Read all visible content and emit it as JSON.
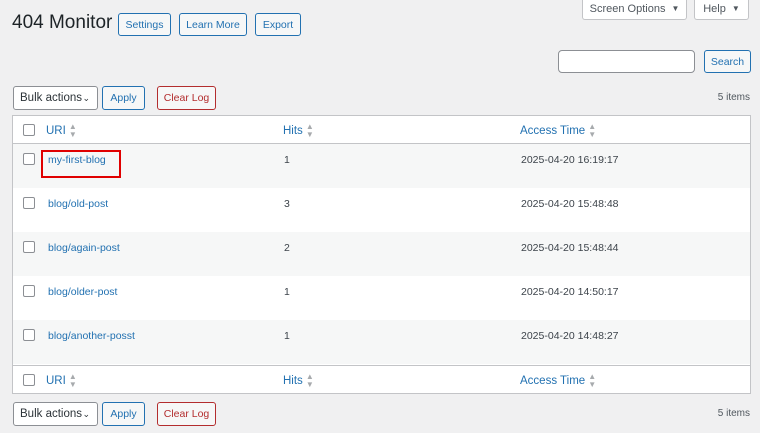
{
  "header": {
    "screen_options_label": "Screen Options",
    "help_label": "Help",
    "title": "404 Monitor",
    "settings_label": "Settings",
    "learn_more_label": "Learn More",
    "export_label": "Export"
  },
  "search": {
    "value": "",
    "button_label": "Search"
  },
  "toolbar_top": {
    "bulk_actions_label": "Bulk actions",
    "apply_label": "Apply",
    "clear_log_label": "Clear Log",
    "count_label": "5 items"
  },
  "toolbar_bottom": {
    "bulk_actions_label": "Bulk actions",
    "apply_label": "Apply",
    "clear_log_label": "Clear Log",
    "count_label": "5 items"
  },
  "table": {
    "columns": [
      "URI",
      "Hits",
      "Access Time"
    ],
    "rows": [
      {
        "uri": "my-first-blog",
        "hits": "1",
        "time": "2025-04-20 16:19:17"
      },
      {
        "uri": "blog/old-post",
        "hits": "3",
        "time": "2025-04-20 15:48:48"
      },
      {
        "uri": "blog/again-post",
        "hits": "2",
        "time": "2025-04-20 15:48:44"
      },
      {
        "uri": "blog/older-post",
        "hits": "1",
        "time": "2025-04-20 14:50:17"
      },
      {
        "uri": "blog/another-posst",
        "hits": "1",
        "time": "2025-04-20 14:48:27"
      }
    ]
  },
  "icons": {
    "caret": "caret-down-icon",
    "sort": "sort-icon"
  },
  "colors": {
    "link": "#2271b1",
    "danger": "#b32d2e",
    "highlight": "#e00000"
  }
}
